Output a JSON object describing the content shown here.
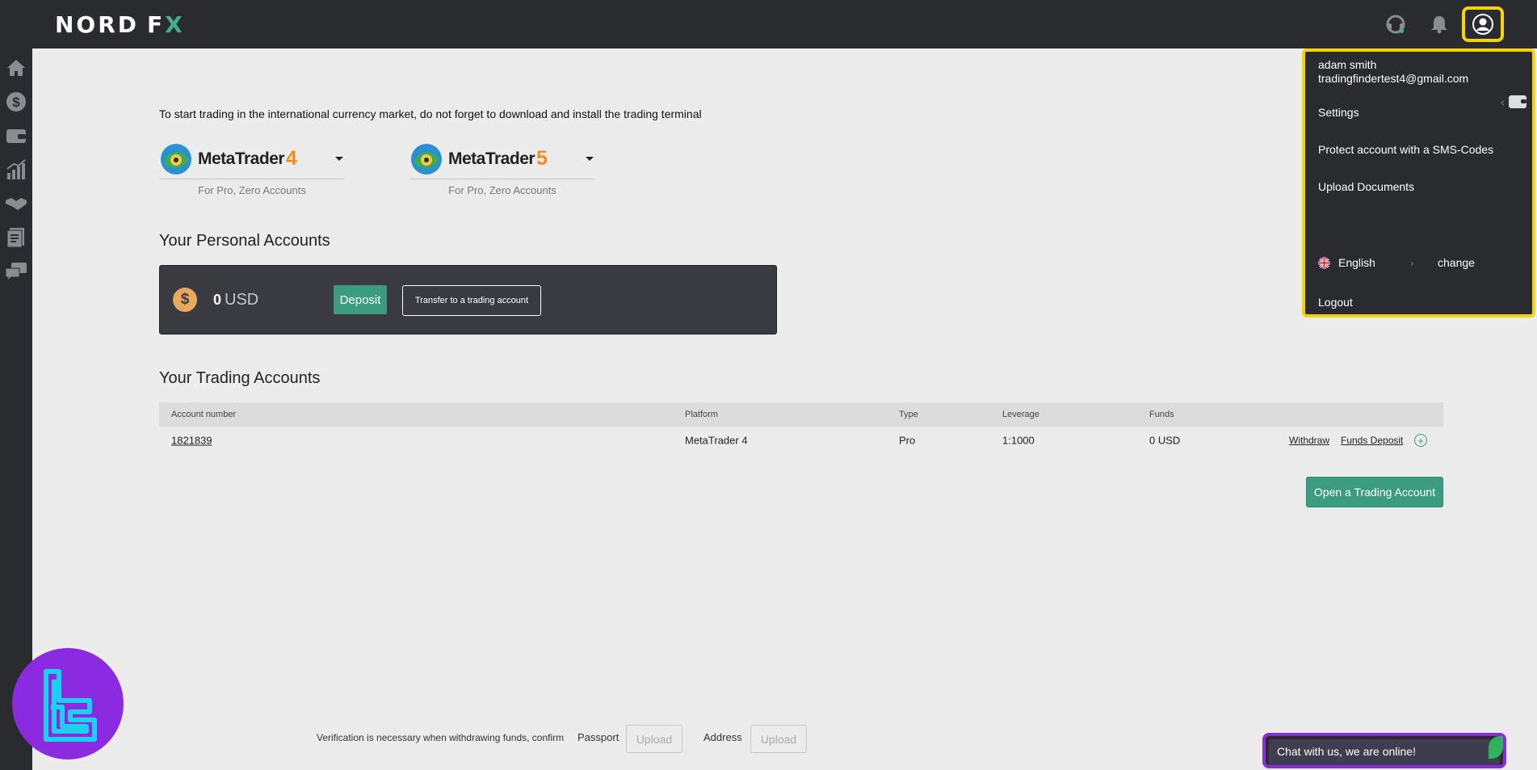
{
  "brand": {
    "logo_left": "NORD",
    "logo_right_f": "F",
    "logo_right_x": "X"
  },
  "topbar": {
    "icons": [
      "headset-icon",
      "bell-icon",
      "user-icon"
    ]
  },
  "sidebar": {
    "icons": [
      "home-icon",
      "dollar-icon",
      "wallet-icon",
      "chart-icon",
      "handshake-icon",
      "documents-icon",
      "chat-icon",
      "chevron-right-icon"
    ]
  },
  "intro": "To start trading in the international currency market, do not forget to download and install the trading terminal",
  "platforms": [
    {
      "name": "MetaTrader",
      "version": "4",
      "subtitle": "For Pro, Zero Accounts"
    },
    {
      "name": "MetaTrader",
      "version": "5",
      "subtitle": "For Pro, Zero Accounts"
    }
  ],
  "personal": {
    "title": "Your Personal Accounts",
    "amount": "0",
    "currency": "USD",
    "deposit_label": "Deposit",
    "transfer_label": "Transfer to a trading account"
  },
  "trading": {
    "title": "Your Trading Accounts",
    "headers": {
      "account": "Account number",
      "platform": "Platform",
      "type": "Type",
      "leverage": "Leverage",
      "funds": "Funds"
    },
    "rows": [
      {
        "account": "1821839",
        "platform": "MetaTrader 4",
        "type": "Pro",
        "leverage": "1:1000",
        "funds": "0 USD",
        "withdraw": "Withdraw",
        "funds_deposit": "Funds Deposit"
      }
    ],
    "open_label": "Open a Trading Account"
  },
  "verification": {
    "text": "Verification is necessary when withdrawing funds, confirm",
    "passport": "Passport",
    "address": "Address",
    "upload": "Upload"
  },
  "dropdown": {
    "name": "adam smith",
    "email": "tradingfindertest4@gmail.com",
    "settings": "Settings",
    "protect": "Protect account with a SMS-Codes",
    "upload_docs": "Upload Documents",
    "language": "English",
    "change": "change",
    "logout": "Logout"
  },
  "chat": {
    "label": "Chat with us, we are online!"
  },
  "colors": {
    "accent": "#3b9c7e",
    "highlight": "#f2d40a",
    "dark": "#2a2b2f",
    "watermark": "#8a2be2"
  }
}
